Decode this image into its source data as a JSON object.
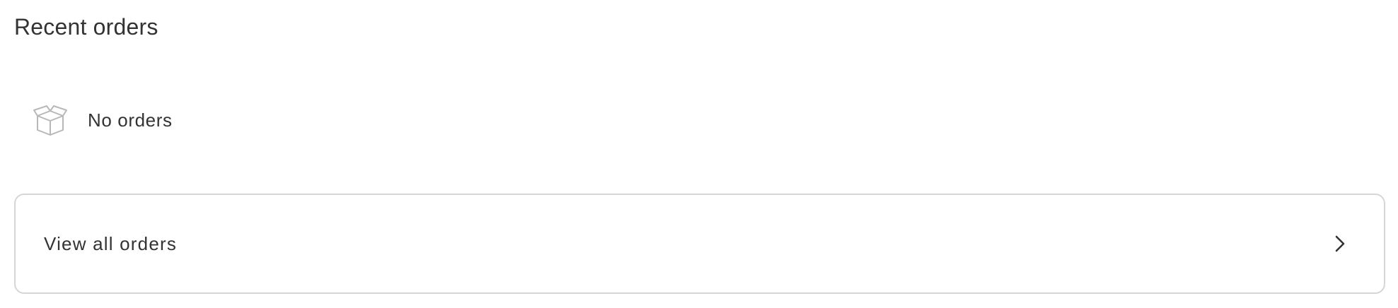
{
  "section": {
    "title": "Recent orders"
  },
  "empty_state": {
    "icon": "open-box-icon",
    "label": "No orders"
  },
  "view_all": {
    "label": "View all orders",
    "icon": "chevron-right-icon"
  },
  "colors": {
    "text": "#333333",
    "border": "#d6d6d6",
    "icon_muted": "#b8b8b8",
    "background": "#ffffff"
  }
}
